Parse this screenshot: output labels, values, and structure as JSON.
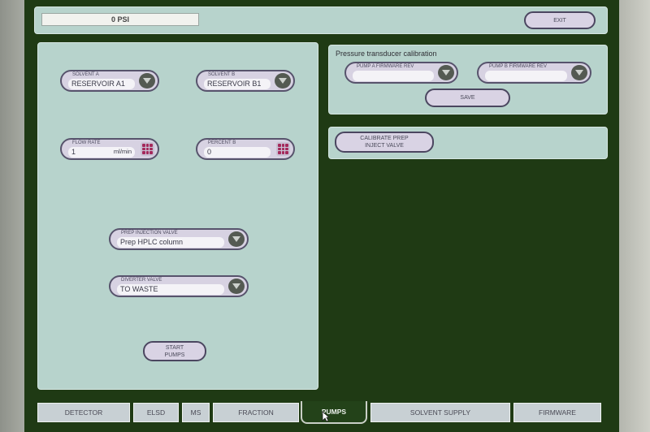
{
  "status": {
    "pressure": "0 PSI"
  },
  "header": {
    "exit_label": "EXIT"
  },
  "solvent_a": {
    "label": "SOLVENT A",
    "value": "RESERVOIR A1"
  },
  "solvent_b": {
    "label": "SOLVENT B",
    "value": "RESERVOIR B1"
  },
  "flow_rate": {
    "label": "FLOW RATE",
    "value": "1",
    "unit": "ml/min"
  },
  "percent_b": {
    "label": "PERCENT B",
    "value": "0"
  },
  "prep_injection_valve": {
    "label": "PREP INJECTION VALVE",
    "value": "Prep HPLC column"
  },
  "diverter_valve": {
    "label": "DIVERTER VALVE",
    "value": "TO WASTE"
  },
  "start_pumps_label": "START\nPUMPS",
  "calibration": {
    "title": "Pressure transducer calibration",
    "pump_a_label": "PUMP A FIRMWARE REV",
    "pump_a_value": "",
    "pump_b_label": "PUMP B FIRMWARE REV",
    "pump_b_value": "",
    "save_label": "SAVE"
  },
  "calibrate_prep_label": "CALIBRATE PREP\nINJECT VALVE",
  "tabs": [
    {
      "label": "DETECTOR"
    },
    {
      "label": "ELSD"
    },
    {
      "label": "MS"
    },
    {
      "label": "FRACTION"
    },
    {
      "label": "PUMPS",
      "active": true
    },
    {
      "label": "SOLVENT SUPPLY"
    },
    {
      "label": "FIRMWARE"
    }
  ],
  "colors": {
    "panel": "#b7d3cc",
    "screen_bg": "#1f3a14",
    "button_fill": "#d9d3e4",
    "keypad_accent": "#a4295b"
  }
}
